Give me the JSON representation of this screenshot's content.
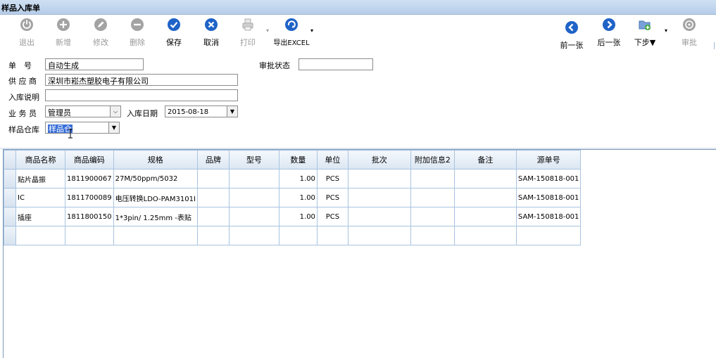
{
  "window": {
    "title": "样品入库单"
  },
  "toolbar": {
    "exit": "退出",
    "add": "新增",
    "edit": "修改",
    "delete": "删除",
    "save": "保存",
    "cancel": "取消",
    "print": "打印",
    "export": "导出EXCEL",
    "prev": "前一张",
    "next": "后一张",
    "next_step": "下步▼",
    "approve": "审批"
  },
  "form": {
    "doc_no_label": "单　号",
    "doc_no_value": "自动生成",
    "approval_label": "审批状态",
    "approval_value": "",
    "supplier_label": "供 应 商",
    "supplier_value": "深圳市崧杰塑胶电子有限公司",
    "desc_label": "入库说明",
    "desc_value": "",
    "clerk_label": "业 务 员",
    "clerk_value": "管理员",
    "date_label": "入库日期",
    "date_value": "2015-08-18",
    "warehouse_label": "样品仓库",
    "warehouse_value": "样品仓"
  },
  "grid": {
    "columns": [
      "商品名称",
      "商品编码",
      "规格",
      "品牌",
      "型号",
      "数量",
      "单位",
      "批次",
      "附加信息2",
      "备注",
      "源单号"
    ],
    "rows": [
      [
        "贴片晶振",
        "1811900067",
        "27M/50ppm/5032",
        "",
        "",
        "1.00",
        "PCS",
        "",
        "",
        "",
        "SAM-150818-001"
      ],
      [
        "IC",
        "1811700089",
        "电压转换LDO-PAM3101I",
        "",
        "",
        "1.00",
        "PCS",
        "",
        "",
        "",
        "SAM-150818-001"
      ],
      [
        "插座",
        "1811800150",
        "1*3pin/ 1.25mm -表贴",
        "",
        "",
        "1.00",
        "PCS",
        "",
        "",
        "",
        "SAM-150818-001"
      ],
      [
        "",
        "",
        "",
        "",
        "",
        "",
        "",
        "",
        "",
        "",
        ""
      ]
    ]
  },
  "icons": {
    "exit": "exit-icon",
    "add": "plus-circle-icon",
    "edit": "edit-icon",
    "delete": "minus-circle-icon",
    "save": "check-circle-icon",
    "cancel": "x-circle-icon",
    "print": "printer-icon",
    "export": "export-icon",
    "prev": "arrow-left-icon",
    "next": "arrow-right-icon",
    "next_step": "folder-plus-icon",
    "approve": "approve-icon"
  },
  "colors": {
    "accent_blue": "#1f63c7",
    "disabled_gray": "#9a9a9a",
    "selection": "#3a6fd8"
  }
}
